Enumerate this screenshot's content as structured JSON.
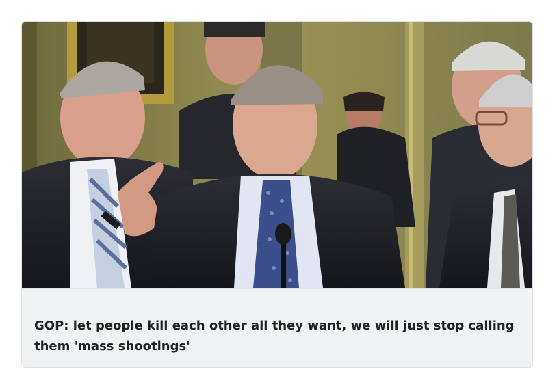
{
  "post": {
    "title": "GOP: let people kill each other all they want, we will just stop calling them 'mass shootings'",
    "image": {
      "content": "photo",
      "palette": {
        "wall": "#8a8450",
        "frame_gold": "#b39a3c",
        "suit_dark": "#22232a",
        "shirt_white": "#e8eaf0",
        "tie_blue": "#3a4f8c",
        "skin": "#d9a58c"
      }
    }
  }
}
